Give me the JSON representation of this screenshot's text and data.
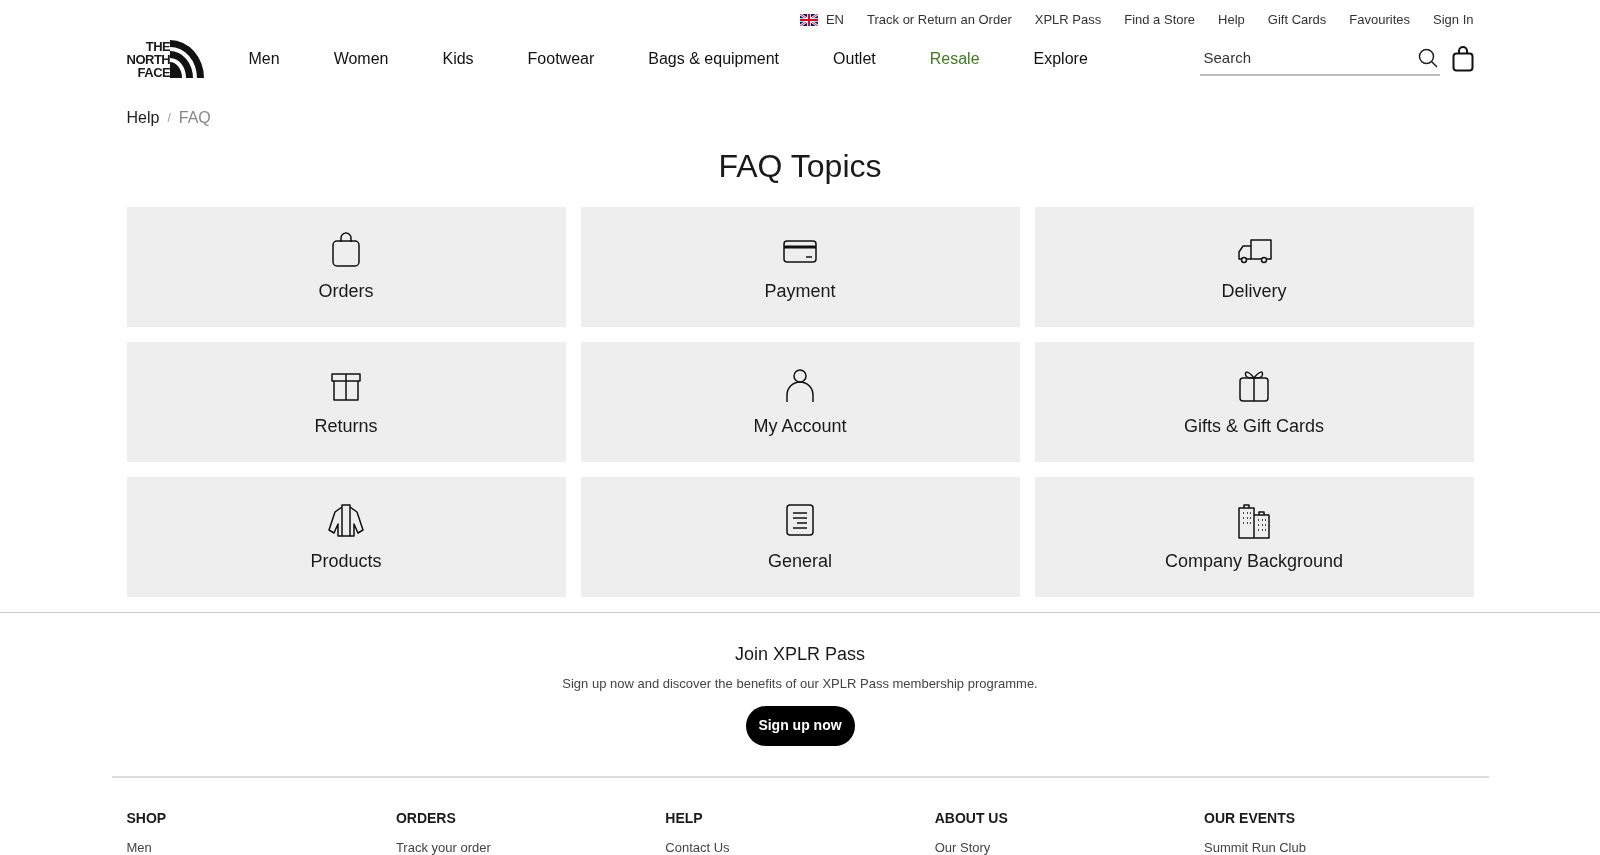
{
  "utility_bar": {
    "language": "EN",
    "links": [
      "Track or Return an Order",
      "XPLR Pass",
      "Find a Store",
      "Help",
      "Gift Cards",
      "Favourites",
      "Sign In"
    ]
  },
  "logo": {
    "lines": [
      "THE",
      "NORTH",
      "FACE"
    ]
  },
  "nav": [
    {
      "label": "Men",
      "highlighted": false
    },
    {
      "label": "Women",
      "highlighted": false
    },
    {
      "label": "Kids",
      "highlighted": false
    },
    {
      "label": "Footwear",
      "highlighted": false
    },
    {
      "label": "Bags & equipment",
      "highlighted": false
    },
    {
      "label": "Outlet",
      "highlighted": false
    },
    {
      "label": "Resale",
      "highlighted": true
    },
    {
      "label": "Explore",
      "highlighted": false
    }
  ],
  "search": {
    "placeholder": "Search"
  },
  "breadcrumb_separator": "/",
  "breadcrumb": [
    {
      "label": "Help",
      "current": false
    },
    {
      "label": "FAQ",
      "current": true
    }
  ],
  "title": "FAQ Topics",
  "topics": [
    {
      "label": "Orders",
      "kind": "bag"
    },
    {
      "label": "Payment",
      "kind": "card"
    },
    {
      "label": "Delivery",
      "kind": "truck"
    },
    {
      "label": "Returns",
      "kind": "box"
    },
    {
      "label": "My Account",
      "kind": "person"
    },
    {
      "label": "Gifts & Gift Cards",
      "kind": "gift"
    },
    {
      "label": "Products",
      "kind": "jacket"
    },
    {
      "label": "General",
      "kind": "document"
    },
    {
      "label": "Company Background",
      "kind": "buildings"
    }
  ],
  "membership": {
    "heading": "Join XPLR Pass",
    "text": "Sign up now and discover the benefits of our XPLR Pass membership programme.",
    "button": "Sign up now"
  },
  "footer": [
    {
      "heading": "SHOP",
      "links": [
        "Men"
      ]
    },
    {
      "heading": "ORDERS",
      "links": [
        "Track your order"
      ]
    },
    {
      "heading": "HELP",
      "links": [
        "Contact Us"
      ]
    },
    {
      "heading": "ABOUT US",
      "links": [
        "Our Story"
      ]
    },
    {
      "heading": "OUR EVENTS",
      "links": [
        "Summit Run Club"
      ]
    }
  ]
}
